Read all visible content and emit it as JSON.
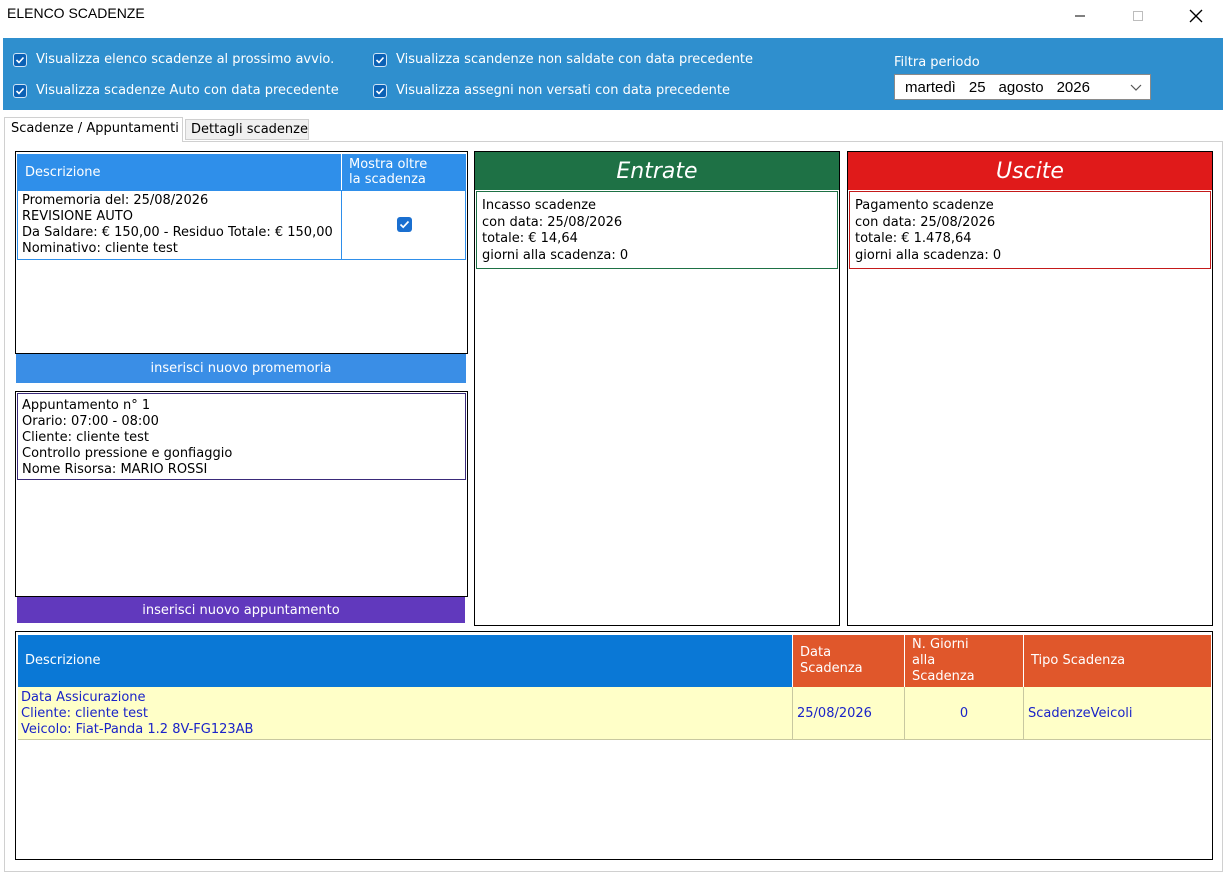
{
  "window": {
    "title": "ELENCO SCADENZE"
  },
  "options": {
    "opt1": "Visualizza elenco scadenze al prossimo avvio.",
    "opt2": "Visualizza scadenze Auto con data precedente",
    "opt3": "Visualizza scandenze non saldate con data precedente",
    "opt4": "Visualizza assegni non versati con data precedente",
    "filter_label": "Filtra periodo",
    "date": {
      "weekday": "martedì",
      "day": "25",
      "month": "agosto",
      "year": "2026"
    }
  },
  "tabs": {
    "active": "Scadenze / Appuntamenti",
    "inactive": "Dettagli scadenze"
  },
  "promemoria": {
    "col_desc": "Descrizione",
    "col_mostra": "Mostra oltre\nla scadenza",
    "row_text": "Promemoria del: 25/08/2026\nREVISIONE AUTO\nDa Saldare: € 150,00 - Residuo Totale: € 150,00\nNominativo: cliente test",
    "row_checked": true,
    "button": "inserisci nuovo promemoria"
  },
  "appuntamento": {
    "text": "Appuntamento n° 1\nOrario: 07:00 - 08:00\nCliente: cliente test\nControllo pressione e gonfiaggio\nNome Risorsa: MARIO ROSSI",
    "button": "inserisci nuovo appuntamento"
  },
  "entrate": {
    "title": "Entrate",
    "card": "Incasso scadenze\ncon data: 25/08/2026\ntotale: € 14,64\ngiorni alla scadenza: 0"
  },
  "uscite": {
    "title": "Uscite",
    "card": "Pagamento scadenze\ncon data: 25/08/2026\ntotale: € 1.478,64\ngiorni alla scadenza: 0"
  },
  "grid": {
    "headers": {
      "desc": "Descrizione",
      "data": "Data\nScadenza",
      "giorni": "N. Giorni\nalla\nScadenza",
      "tipo": "Tipo Scadenza"
    },
    "rows": [
      {
        "desc": "Data Assicurazione\nCliente: cliente test\nVeicolo: Fiat-Panda 1.2 8V-FG123AB",
        "data": "25/08/2026",
        "giorni": "0",
        "tipo": "ScadenzeVeicoli"
      }
    ]
  },
  "colors": {
    "option_bar": "#2f8fce",
    "header_blue": "#2f8fea",
    "button_blue": "#3a8ee6",
    "button_purple": "#6139bd",
    "entrate_green": "#1e7145",
    "uscite_red": "#e01a1a",
    "grid_desc_header": "#0a78d6",
    "grid_other_header": "#e0572b",
    "grid_row_bg": "#ffffc8",
    "grid_text": "#1a23c8"
  }
}
